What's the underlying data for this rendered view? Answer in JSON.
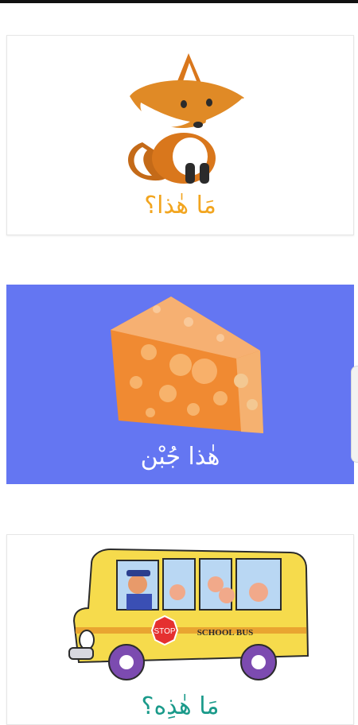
{
  "cards": [
    {
      "id": "fox",
      "caption": "مَا هٰذا؟",
      "caption_color": "#f2a51f",
      "image": "fox-illustration"
    },
    {
      "id": "cheese",
      "caption": "هٰذا جُبْن",
      "caption_color": "#ffffff",
      "background": "#6476f2",
      "image": "cheese-illustration"
    },
    {
      "id": "bus",
      "caption": "مَا هٰذِه؟",
      "caption_color": "#1a9a8a",
      "image": "school-bus-illustration",
      "bus_sign": "SCHOOL BUS",
      "stop_sign": "STOP"
    }
  ]
}
